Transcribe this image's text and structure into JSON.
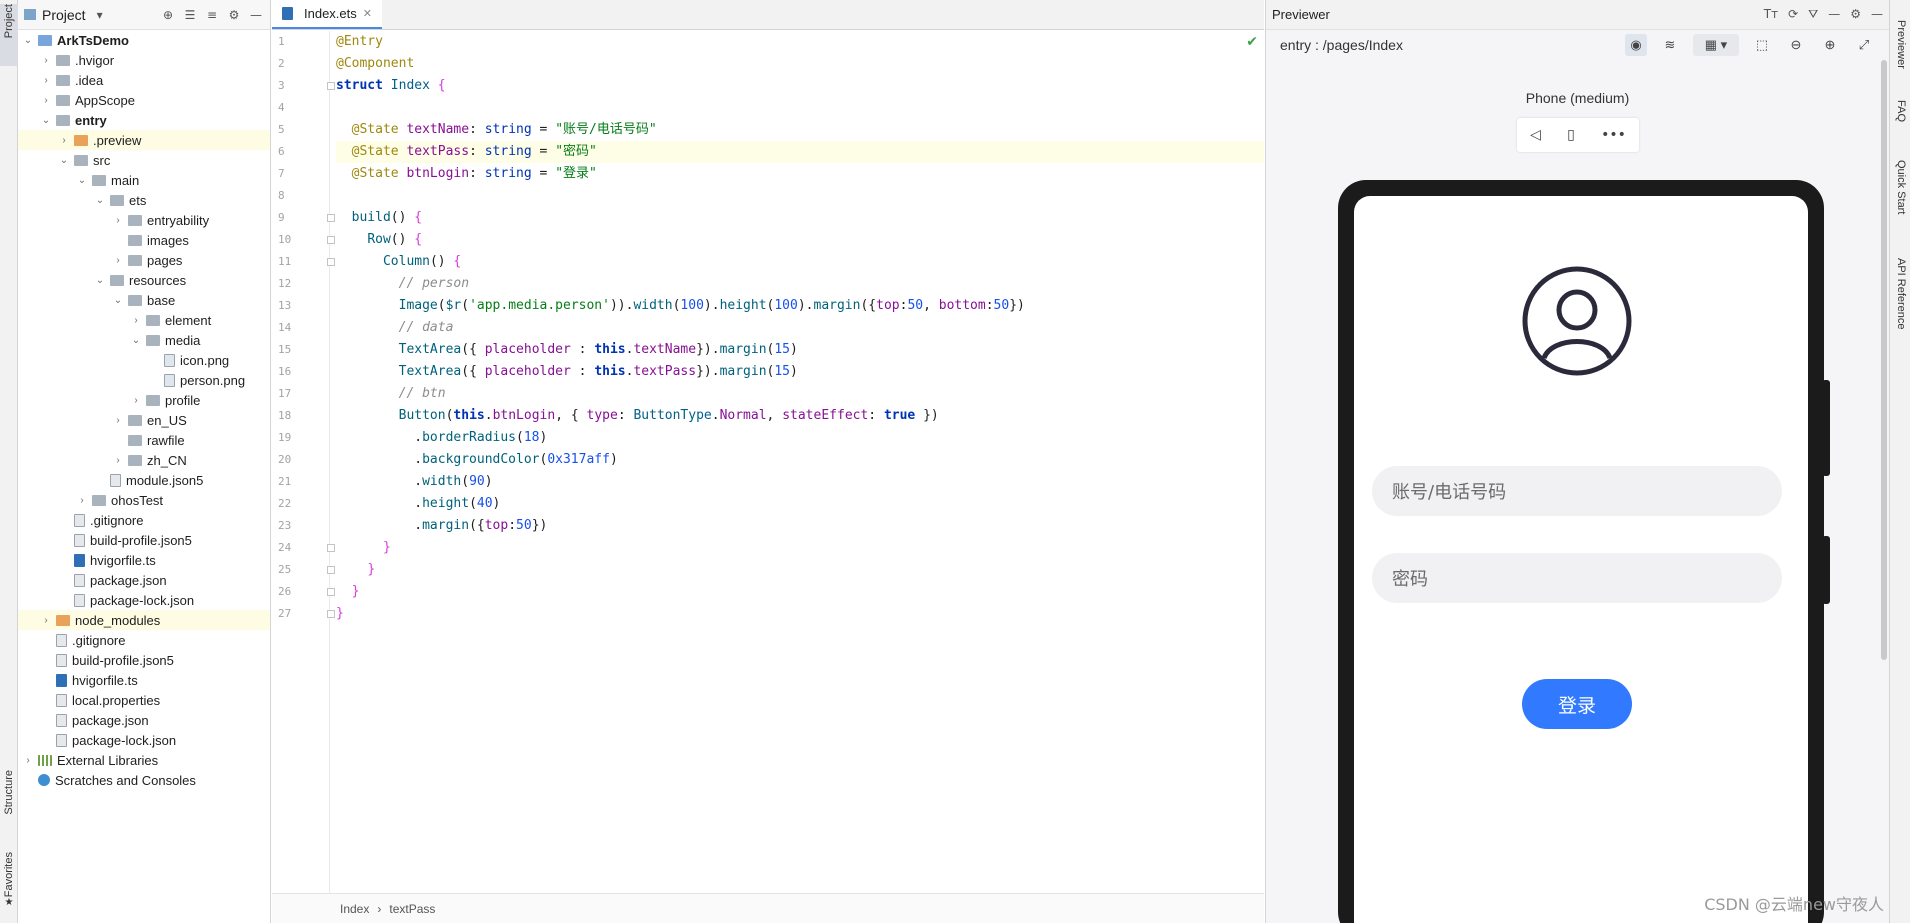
{
  "left_strip": {
    "project_tab": "Project",
    "structure_tab": "Structure",
    "favorites_tab": "Favorites"
  },
  "project_panel": {
    "title": "Project",
    "tree": [
      {
        "label": "ArkTsDemo",
        "depth": 0,
        "chev": "down",
        "icon": "folder-blue",
        "bold": true
      },
      {
        "label": ".hvigor",
        "depth": 1,
        "chev": "right",
        "icon": "folder"
      },
      {
        "label": ".idea",
        "depth": 1,
        "chev": "right",
        "icon": "folder"
      },
      {
        "label": "AppScope",
        "depth": 1,
        "chev": "right",
        "icon": "folder"
      },
      {
        "label": "entry",
        "depth": 1,
        "chev": "down",
        "icon": "folder",
        "bold": true
      },
      {
        "label": ".preview",
        "depth": 2,
        "chev": "right",
        "icon": "folder-orange",
        "highlight": true
      },
      {
        "label": "src",
        "depth": 2,
        "chev": "down",
        "icon": "folder"
      },
      {
        "label": "main",
        "depth": 3,
        "chev": "down",
        "icon": "folder"
      },
      {
        "label": "ets",
        "depth": 4,
        "chev": "down",
        "icon": "folder"
      },
      {
        "label": "entryability",
        "depth": 5,
        "chev": "right",
        "icon": "folder"
      },
      {
        "label": "images",
        "depth": 5,
        "chev": "",
        "icon": "folder"
      },
      {
        "label": "pages",
        "depth": 5,
        "chev": "right",
        "icon": "folder"
      },
      {
        "label": "resources",
        "depth": 4,
        "chev": "down",
        "icon": "folder"
      },
      {
        "label": "base",
        "depth": 5,
        "chev": "down",
        "icon": "folder"
      },
      {
        "label": "element",
        "depth": 6,
        "chev": "right",
        "icon": "folder"
      },
      {
        "label": "media",
        "depth": 6,
        "chev": "down",
        "icon": "folder"
      },
      {
        "label": "icon.png",
        "depth": 7,
        "chev": "",
        "icon": "file-png"
      },
      {
        "label": "person.png",
        "depth": 7,
        "chev": "",
        "icon": "file-png"
      },
      {
        "label": "profile",
        "depth": 6,
        "chev": "right",
        "icon": "folder"
      },
      {
        "label": "en_US",
        "depth": 5,
        "chev": "right",
        "icon": "folder"
      },
      {
        "label": "rawfile",
        "depth": 5,
        "chev": "",
        "icon": "folder"
      },
      {
        "label": "zh_CN",
        "depth": 5,
        "chev": "right",
        "icon": "folder"
      },
      {
        "label": "module.json5",
        "depth": 4,
        "chev": "",
        "icon": "file"
      },
      {
        "label": "ohosTest",
        "depth": 3,
        "chev": "right",
        "icon": "folder"
      },
      {
        "label": ".gitignore",
        "depth": 2,
        "chev": "",
        "icon": "file"
      },
      {
        "label": "build-profile.json5",
        "depth": 2,
        "chev": "",
        "icon": "file"
      },
      {
        "label": "hvigorfile.ts",
        "depth": 2,
        "chev": "",
        "icon": "file-ts"
      },
      {
        "label": "package.json",
        "depth": 2,
        "chev": "",
        "icon": "file"
      },
      {
        "label": "package-lock.json",
        "depth": 2,
        "chev": "",
        "icon": "file"
      },
      {
        "label": "node_modules",
        "depth": 1,
        "chev": "right",
        "icon": "folder-orange",
        "highlight": true
      },
      {
        "label": ".gitignore",
        "depth": 1,
        "chev": "",
        "icon": "file"
      },
      {
        "label": "build-profile.json5",
        "depth": 1,
        "chev": "",
        "icon": "file"
      },
      {
        "label": "hvigorfile.ts",
        "depth": 1,
        "chev": "",
        "icon": "file-ts"
      },
      {
        "label": "local.properties",
        "depth": 1,
        "chev": "",
        "icon": "file"
      },
      {
        "label": "package.json",
        "depth": 1,
        "chev": "",
        "icon": "file"
      },
      {
        "label": "package-lock.json",
        "depth": 1,
        "chev": "",
        "icon": "file"
      },
      {
        "label": "External Libraries",
        "depth": 0,
        "chev": "right",
        "icon": "lib"
      },
      {
        "label": "Scratches and Consoles",
        "depth": 0,
        "chev": "",
        "icon": "scratch"
      }
    ]
  },
  "editor": {
    "tab_label": "Index.ets",
    "current_line": 6,
    "lines": [
      [
        [
          "t-ann",
          "@Entry"
        ]
      ],
      [
        [
          "t-ann",
          "@Component"
        ]
      ],
      [
        [
          "t-kwb",
          "struct "
        ],
        [
          "t-ty",
          "Index "
        ],
        [
          "t-br",
          "{"
        ]
      ],
      [],
      [
        [
          "t-pl",
          "  "
        ],
        [
          "t-ann",
          "@State "
        ],
        [
          "t-pp",
          "textName"
        ],
        [
          "t-pl",
          ": "
        ],
        [
          "t-kw",
          "string"
        ],
        [
          "t-pl",
          " = "
        ],
        [
          "t-st",
          "\"账号/电话号码\""
        ]
      ],
      [
        [
          "t-pl",
          "  "
        ],
        [
          "t-ann",
          "@State "
        ],
        [
          "t-pp",
          "textPass"
        ],
        [
          "t-pl",
          ": "
        ],
        [
          "t-kw",
          "string"
        ],
        [
          "t-pl",
          " = "
        ],
        [
          "t-st",
          "\"密码\""
        ]
      ],
      [
        [
          "t-pl",
          "  "
        ],
        [
          "t-ann",
          "@State "
        ],
        [
          "t-pp",
          "btnLogin"
        ],
        [
          "t-pl",
          ": "
        ],
        [
          "t-kw",
          "string"
        ],
        [
          "t-pl",
          " = "
        ],
        [
          "t-st",
          "\"登录\""
        ]
      ],
      [],
      [
        [
          "t-pl",
          "  "
        ],
        [
          "t-fn",
          "build"
        ],
        [
          "t-pl",
          "() "
        ],
        [
          "t-br",
          "{"
        ]
      ],
      [
        [
          "t-pl",
          "    "
        ],
        [
          "t-fn",
          "Row"
        ],
        [
          "t-pl",
          "() "
        ],
        [
          "t-br",
          "{"
        ]
      ],
      [
        [
          "t-pl",
          "      "
        ],
        [
          "t-fn",
          "Column"
        ],
        [
          "t-pl",
          "() "
        ],
        [
          "t-br",
          "{"
        ]
      ],
      [
        [
          "t-pl",
          "        "
        ],
        [
          "t-cm",
          "// person"
        ]
      ],
      [
        [
          "t-pl",
          "        "
        ],
        [
          "t-fn",
          "Image"
        ],
        [
          "t-pl",
          "("
        ],
        [
          "t-fn",
          "$r"
        ],
        [
          "t-pl",
          "("
        ],
        [
          "t-st",
          "'app.media.person'"
        ],
        [
          "t-pl",
          "))."
        ],
        [
          "t-fn",
          "width"
        ],
        [
          "t-pl",
          "("
        ],
        [
          "t-num",
          "100"
        ],
        [
          "t-pl",
          ")."
        ],
        [
          "t-fn",
          "height"
        ],
        [
          "t-pl",
          "("
        ],
        [
          "t-num",
          "100"
        ],
        [
          "t-pl",
          ")."
        ],
        [
          "t-fn",
          "margin"
        ],
        [
          "t-pl",
          "({"
        ],
        [
          "t-pp",
          "top"
        ],
        [
          "t-pl",
          ":"
        ],
        [
          "t-num",
          "50"
        ],
        [
          "t-pl",
          ", "
        ],
        [
          "t-pp",
          "bottom"
        ],
        [
          "t-pl",
          ":"
        ],
        [
          "t-num",
          "50"
        ],
        [
          "t-pl",
          "})"
        ]
      ],
      [
        [
          "t-pl",
          "        "
        ],
        [
          "t-cm",
          "// data"
        ]
      ],
      [
        [
          "t-pl",
          "        "
        ],
        [
          "t-fn",
          "TextArea"
        ],
        [
          "t-pl",
          "({ "
        ],
        [
          "t-pp",
          "placeholder"
        ],
        [
          "t-pl",
          " : "
        ],
        [
          "t-kwb",
          "this"
        ],
        [
          "t-pl",
          "."
        ],
        [
          "t-pp",
          "textName"
        ],
        [
          "t-pl",
          "})."
        ],
        [
          "t-fn",
          "margin"
        ],
        [
          "t-pl",
          "("
        ],
        [
          "t-num",
          "15"
        ],
        [
          "t-pl",
          ")"
        ]
      ],
      [
        [
          "t-pl",
          "        "
        ],
        [
          "t-fn",
          "TextArea"
        ],
        [
          "t-pl",
          "({ "
        ],
        [
          "t-pp",
          "placeholder"
        ],
        [
          "t-pl",
          " : "
        ],
        [
          "t-kwb",
          "this"
        ],
        [
          "t-pl",
          "."
        ],
        [
          "t-pp",
          "textPass"
        ],
        [
          "t-pl",
          "})."
        ],
        [
          "t-fn",
          "margin"
        ],
        [
          "t-pl",
          "("
        ],
        [
          "t-num",
          "15"
        ],
        [
          "t-pl",
          ")"
        ]
      ],
      [
        [
          "t-pl",
          "        "
        ],
        [
          "t-cm",
          "// btn"
        ]
      ],
      [
        [
          "t-pl",
          "        "
        ],
        [
          "t-fn",
          "Button"
        ],
        [
          "t-pl",
          "("
        ],
        [
          "t-kwb",
          "this"
        ],
        [
          "t-pl",
          "."
        ],
        [
          "t-pp",
          "btnLogin"
        ],
        [
          "t-pl",
          ", { "
        ],
        [
          "t-pp",
          "type"
        ],
        [
          "t-pl",
          ": "
        ],
        [
          "t-ty",
          "ButtonType"
        ],
        [
          "t-pl",
          "."
        ],
        [
          "t-pp",
          "Normal"
        ],
        [
          "t-pl",
          ", "
        ],
        [
          "t-pp",
          "stateEffect"
        ],
        [
          "t-pl",
          ": "
        ],
        [
          "t-kwb",
          "true"
        ],
        [
          "t-pl",
          " })"
        ]
      ],
      [
        [
          "t-pl",
          "          ."
        ],
        [
          "t-fn",
          "borderRadius"
        ],
        [
          "t-pl",
          "("
        ],
        [
          "t-num",
          "18"
        ],
        [
          "t-pl",
          ")"
        ]
      ],
      [
        [
          "t-pl",
          "          ."
        ],
        [
          "t-fn",
          "backgroundColor"
        ],
        [
          "t-pl",
          "("
        ],
        [
          "t-num",
          "0x317aff"
        ],
        [
          "t-pl",
          ")"
        ]
      ],
      [
        [
          "t-pl",
          "          ."
        ],
        [
          "t-fn",
          "width"
        ],
        [
          "t-pl",
          "("
        ],
        [
          "t-num",
          "90"
        ],
        [
          "t-pl",
          ")"
        ]
      ],
      [
        [
          "t-pl",
          "          ."
        ],
        [
          "t-fn",
          "height"
        ],
        [
          "t-pl",
          "("
        ],
        [
          "t-num",
          "40"
        ],
        [
          "t-pl",
          ")"
        ]
      ],
      [
        [
          "t-pl",
          "          ."
        ],
        [
          "t-fn",
          "margin"
        ],
        [
          "t-pl",
          "({"
        ],
        [
          "t-pp",
          "top"
        ],
        [
          "t-pl",
          ":"
        ],
        [
          "t-num",
          "50"
        ],
        [
          "t-pl",
          "})"
        ]
      ],
      [
        [
          "t-pl",
          "      "
        ],
        [
          "t-br",
          "}"
        ]
      ],
      [
        [
          "t-pl",
          "    "
        ],
        [
          "t-br",
          "}"
        ]
      ],
      [
        [
          "t-pl",
          "  "
        ],
        [
          "t-br",
          "}"
        ]
      ],
      [
        [
          "t-br",
          "}"
        ]
      ]
    ],
    "breadcrumb": [
      "Index",
      "textPass"
    ]
  },
  "previewer": {
    "title": "Previewer",
    "route": "entry : /pages/Index",
    "device_label": "Phone (medium)",
    "placeholder_name": "账号/电话号码",
    "placeholder_pass": "密码",
    "login_label": "登录",
    "button_color": "#317aff"
  },
  "right_strip": {
    "previewer_tab": "Previewer",
    "faq_tab": "FAQ",
    "quickstart_tab": "Quick Start",
    "api_tab": "API Reference"
  },
  "watermark": "CSDN @云端new守夜人"
}
